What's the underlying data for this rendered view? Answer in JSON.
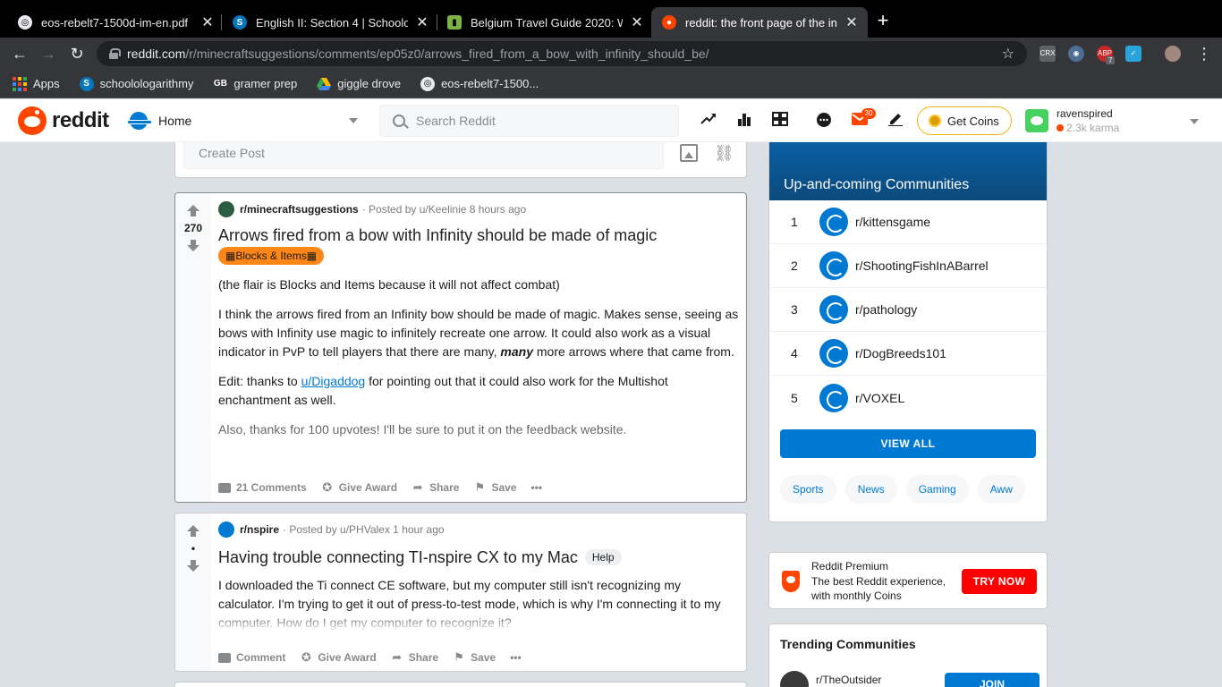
{
  "browser": {
    "tabs": [
      {
        "title": "eos-rebelt7-1500d-im-en.pdf",
        "active": false
      },
      {
        "title": "English II: Section 4 | Schoolog",
        "active": false
      },
      {
        "title": "Belgium Travel Guide 2020: Wh",
        "active": false
      },
      {
        "title": "reddit: the front page of the int",
        "active": true
      }
    ],
    "url_host": "reddit.com",
    "url_path": "/r/minecraftsuggestions/comments/ep05z0/arrows_fired_from_a_bow_with_infinity_should_be/",
    "bookmarks": [
      "Apps",
      "schoolologarithmy",
      "gramer prep",
      "giggle drove",
      "eos-rebelt7-1500..."
    ],
    "ext_badge": "7"
  },
  "header": {
    "logo_text": "reddit",
    "home_label": "Home",
    "search_placeholder": "Search Reddit",
    "mail_badge": "30",
    "get_coins": "Get Coins",
    "username": "ravenspired",
    "karma": "2.3k karma"
  },
  "create_post": {
    "placeholder": "Create Post"
  },
  "posts": [
    {
      "subreddit": "r/minecraftsuggestions",
      "posted_by": "· Posted by u/Keelinie 8 hours ago",
      "score": "270",
      "title": "Arrows fired from a bow with Infinity should be made of magic",
      "flair": "▦Blocks & Items▦",
      "paragraphs": {
        "p1": "(the flair is Blocks and Items because it will not affect combat)",
        "p2a": "I think the arrows fired from an Infinity bow should be made of magic. Makes sense, seeing as bows with Infinity use magic to infinitely recreate one arrow. It could also work as a visual indicator in PvP to tell players that there are many, ",
        "p2_em": "many",
        "p2b": " more arrows where that came from.",
        "p3a": "Edit: thanks to ",
        "p3_link": "u/Digaddog",
        "p3b": " for pointing out that it could also work for the Multishot enchantment as well.",
        "p4": "Also, thanks for 100 upvotes! I'll be sure to put it on the feedback website."
      },
      "actions": {
        "comments": "21 Comments",
        "award": "Give Award",
        "share": "Share",
        "save": "Save",
        "more": "•••"
      }
    },
    {
      "subreddit": "r/nspire",
      "posted_by": "· Posted by u/PHValex 1 hour ago",
      "score": "•",
      "title": "Having trouble connecting TI-nspire CX to my Mac",
      "flair": "Help",
      "body": "I downloaded the Ti connect CE software, but my computer still isn't recognizing my calculator. I'm trying to get it out of press-to-test mode, which is why I'm connecting it to my computer. How do I get my computer to recognize it?",
      "actions": {
        "comments": "Comment",
        "award": "Give Award",
        "share": "Share",
        "save": "Save",
        "more": "•••"
      }
    }
  ],
  "sidebar": {
    "communities_title": "Up-and-coming Communities",
    "communities": [
      {
        "rank": "1",
        "name": "r/kittensgame"
      },
      {
        "rank": "2",
        "name": "r/ShootingFishInABarrel"
      },
      {
        "rank": "3",
        "name": "r/pathology"
      },
      {
        "rank": "4",
        "name": "r/DogBreeds101"
      },
      {
        "rank": "5",
        "name": "r/VOXEL"
      }
    ],
    "view_all": "VIEW ALL",
    "chips": [
      "Sports",
      "News",
      "Gaming",
      "Aww"
    ],
    "premium": {
      "title": "Reddit Premium",
      "desc": "The best Reddit experience, with monthly Coins",
      "button": "TRY NOW"
    },
    "trending": {
      "title": "Trending Communities",
      "first": "r/TheOutsider",
      "join": "JOIN"
    }
  },
  "colors": {
    "accent": "#0079d3",
    "brand": "#ff4500",
    "flair": "#ff8717"
  }
}
